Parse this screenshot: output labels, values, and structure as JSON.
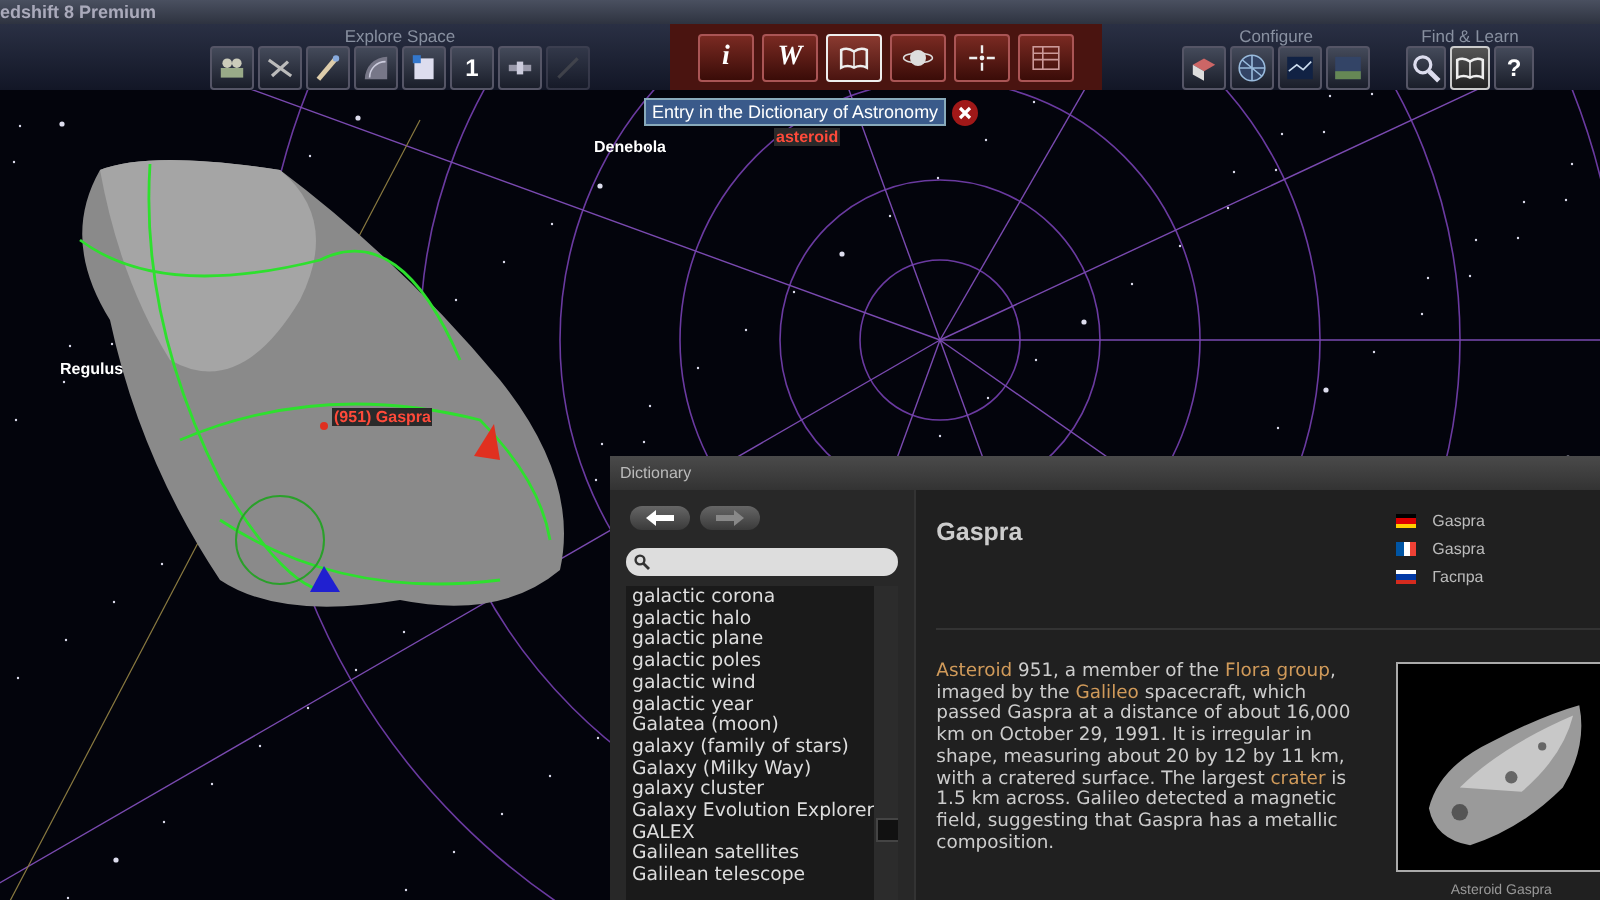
{
  "window": {
    "title": "edshift 8 Premium"
  },
  "toolbar": {
    "groups": [
      {
        "kind": "explore",
        "label": "Explore Space",
        "tools": [
          {
            "selected": false
          },
          {
            "selected": false
          },
          {
            "selected": false
          },
          {
            "selected": false
          },
          {
            "selected": false
          },
          {
            "selected": false,
            "text": "1"
          },
          {
            "selected": false
          },
          {
            "selected": false,
            "disabled": true
          }
        ]
      },
      {
        "kind": "info",
        "tools": [
          {
            "selected": false,
            "text": "i"
          },
          {
            "selected": false,
            "text": "W"
          },
          {
            "selected": true
          },
          {
            "selected": false
          },
          {
            "selected": false
          },
          {
            "selected": false
          }
        ]
      },
      {
        "kind": "configure",
        "label": "Configure",
        "tools": [
          {
            "selected": false
          },
          {
            "selected": false
          },
          {
            "selected": false
          },
          {
            "selected": false
          }
        ]
      },
      {
        "kind": "find",
        "label": "Find & Learn",
        "tools": [
          {
            "selected": false
          },
          {
            "selected": true
          },
          {
            "selected": false,
            "text": "?"
          }
        ]
      }
    ]
  },
  "tooltip": {
    "text": "Entry in the Dictionary of Astronomy"
  },
  "sky": {
    "labels": [
      {
        "kind": "star",
        "text": "Denebola"
      },
      {
        "kind": "star",
        "text": "Regulus"
      },
      {
        "kind": "object",
        "text": "(951) Gaspra"
      },
      {
        "kind": "object",
        "text": "asteroid"
      }
    ]
  },
  "dictionary": {
    "title": "Dictionary",
    "nav": [
      {
        "kind": "back",
        "disabled": false
      },
      {
        "kind": "forward",
        "disabled": true
      }
    ],
    "items": [
      "galactic corona",
      "galactic halo",
      "galactic plane",
      "galactic poles",
      "galactic wind",
      "galactic year",
      "Galatea (moon)",
      "galaxy (family of stars)",
      "Galaxy (Milky Way)",
      "galaxy cluster",
      "Galaxy Evolution Explorer",
      "GALEX",
      "Galilean satellites",
      "Galilean telescope"
    ],
    "entry": {
      "title": "Gaspra",
      "names": [
        {
          "text": "Gaspra"
        },
        {
          "text": "Gaspra"
        },
        {
          "text": "Гаспра"
        }
      ],
      "description": [
        {
          "text": "Asteroid",
          "link": true
        },
        {
          "text": " 951, a member of the ",
          "link": false
        },
        {
          "text": "Flora group",
          "link": true
        },
        {
          "text": ", imaged by the ",
          "link": false
        },
        {
          "text": "Galileo",
          "link": true
        },
        {
          "text": " spacecraft, which passed Gaspra at a distance of about 16,000 km on October 29, 1991. It is irregular in shape, measuring about 20 by 12 by 11 km, with a cratered surface. The largest ",
          "link": false
        },
        {
          "text": "crater",
          "link": true
        },
        {
          "text": " is 1.5 km across. Galileo detected a magnetic field, suggesting that Gaspra has a metallic composition.",
          "link": false
        }
      ],
      "image": {
        "kind": "picture",
        "caption": "Asteroid Gaspra"
      }
    }
  }
}
